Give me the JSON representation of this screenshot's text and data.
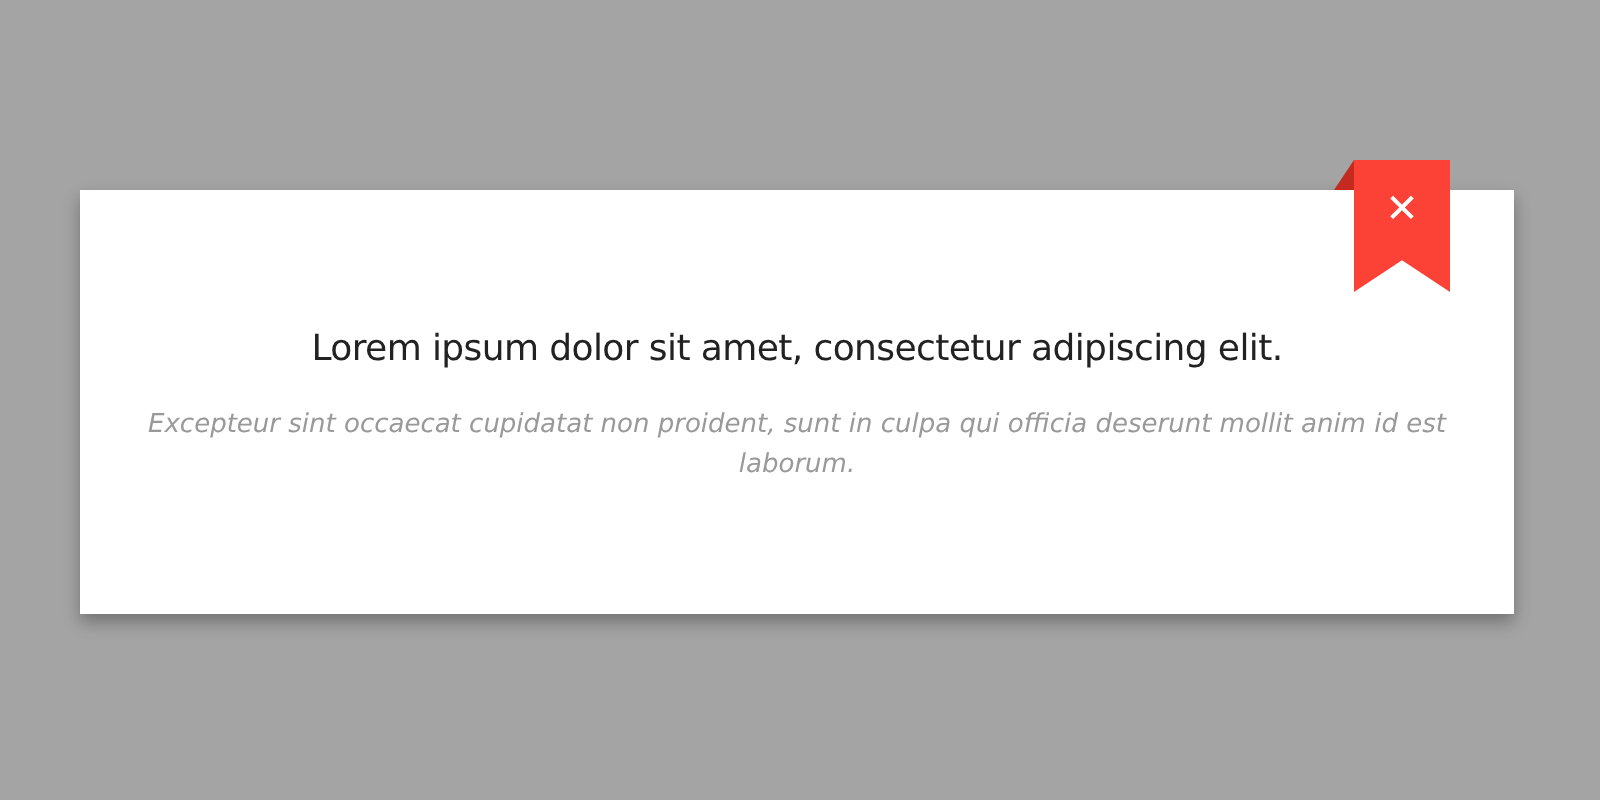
{
  "dialog": {
    "title": "Lorem ipsum dolor sit amet, consectetur adipiscing elit.",
    "message": "Excepteur sint occaecat cupidatat non proident, sunt in culpa qui officia deserunt mollit anim id est laborum.",
    "close": "✕"
  }
}
